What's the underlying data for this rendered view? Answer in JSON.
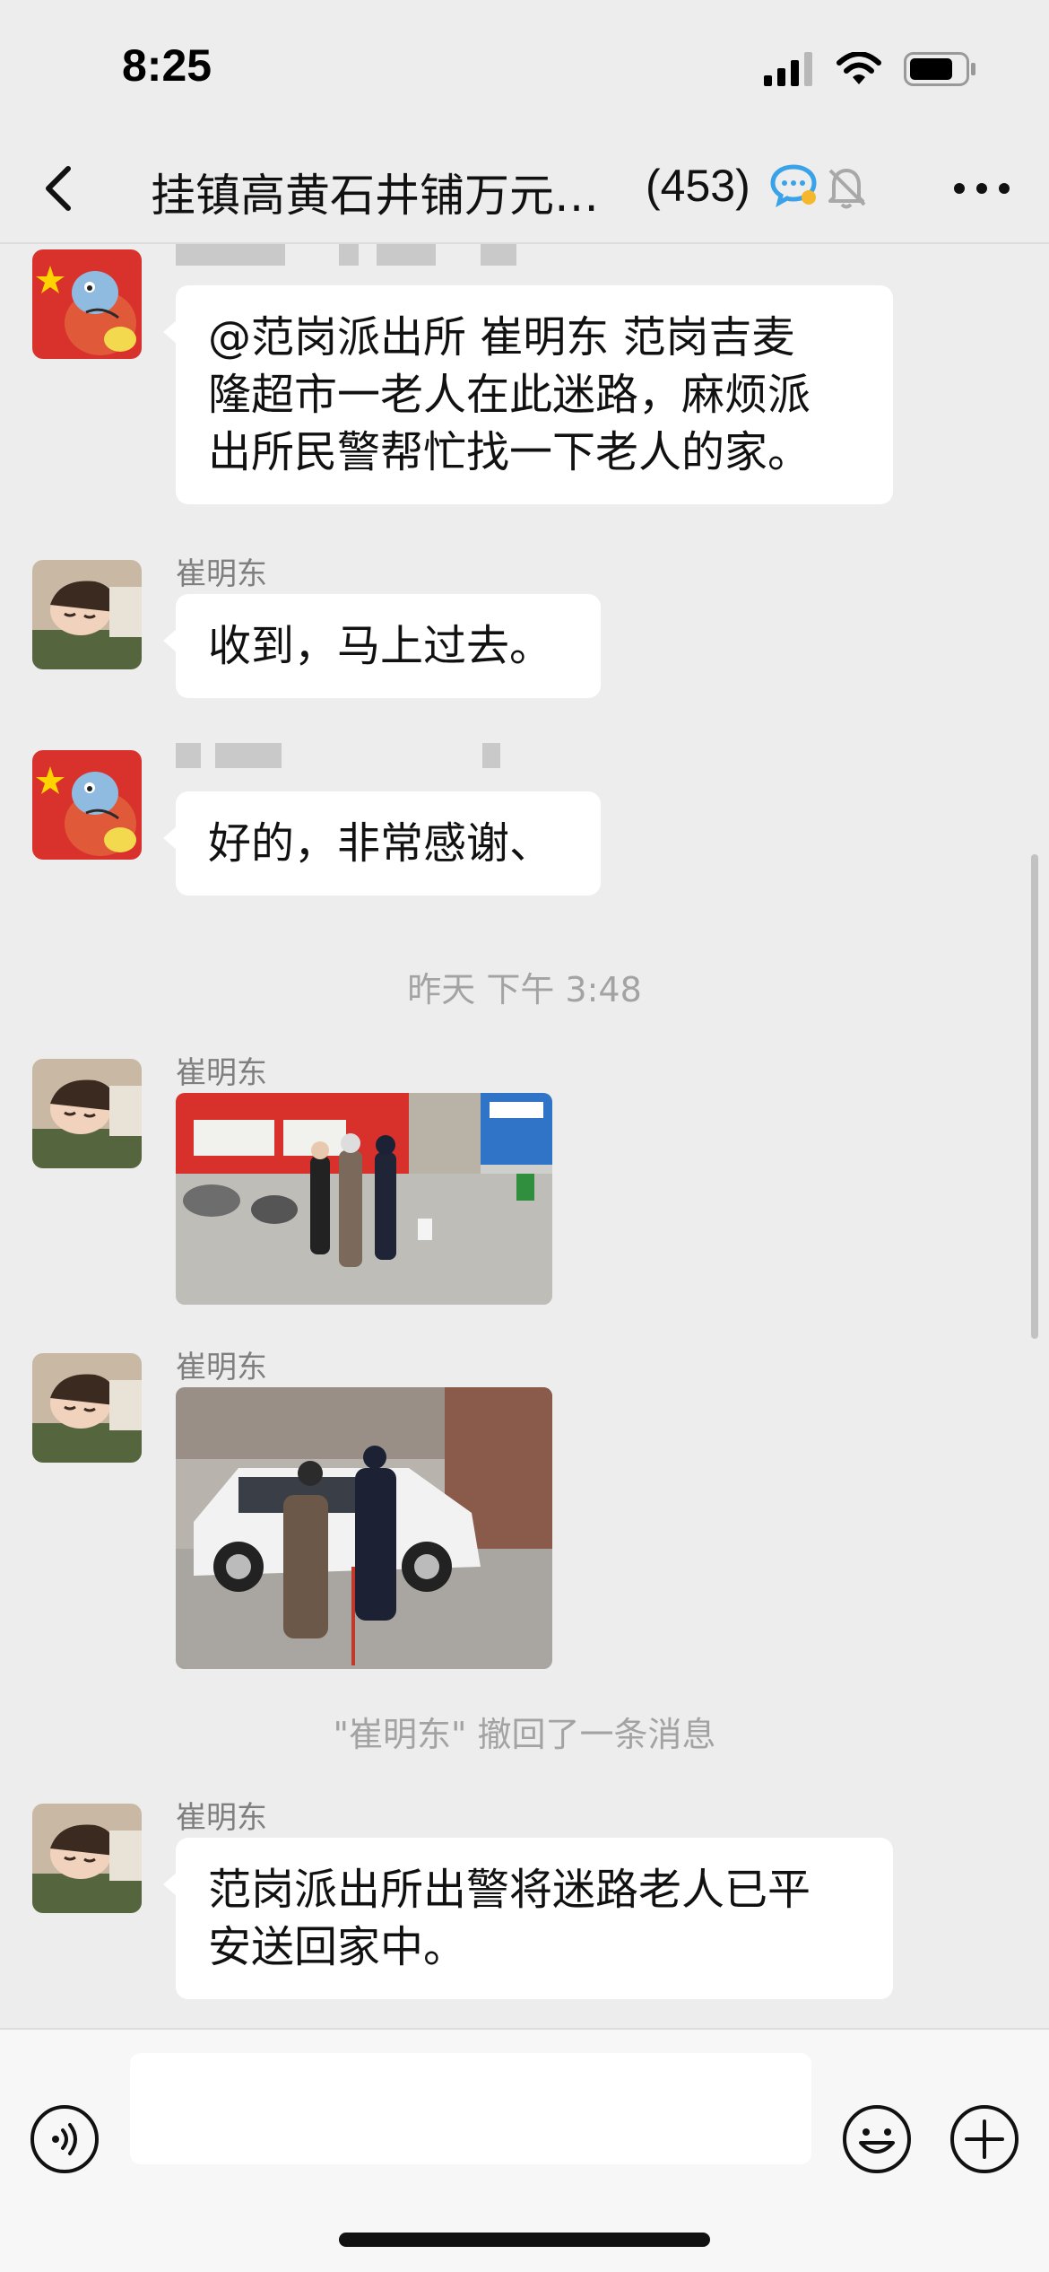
{
  "status_bar": {
    "time": "8:25"
  },
  "header": {
    "title": "挂镇高黄石井铺万元…",
    "member_count": "(453)"
  },
  "messages": [
    {
      "type": "text",
      "sender": "",
      "avatar": "cartoon-avatar",
      "text_lines": [
        "@范岗派出所 崔明东 范岗吉麦",
        "隆超市一老人在此迷路，麻烦派",
        "出所民警帮忙找一下老人的家。"
      ]
    },
    {
      "type": "text",
      "sender": "崔明东",
      "avatar": "sleeping-child-avatar",
      "text_lines": [
        "收到，马上过去。"
      ]
    },
    {
      "type": "text",
      "sender": "",
      "avatar": "cartoon-avatar",
      "text_lines": [
        "好的，非常感谢、"
      ]
    },
    {
      "type": "timestamp",
      "text": "昨天 下午 3:48"
    },
    {
      "type": "image",
      "sender": "崔明东",
      "avatar": "sleeping-child-avatar",
      "image": "police-escorting-elderly-man-street-photo"
    },
    {
      "type": "image",
      "sender": "崔明东",
      "avatar": "sleeping-child-avatar",
      "image": "police-car-elderly-man-photo"
    },
    {
      "type": "system",
      "text": "\"崔明东\" 撤回了一条消息"
    },
    {
      "type": "text",
      "sender": "崔明东",
      "avatar": "sleeping-child-avatar",
      "text_lines": [
        "范岗派出所出警将迷路老人已平",
        "安送回家中。"
      ]
    }
  ],
  "colors": {
    "background": "#ededed",
    "bubble": "#ffffff",
    "meta_text": "#a3a3a3"
  }
}
